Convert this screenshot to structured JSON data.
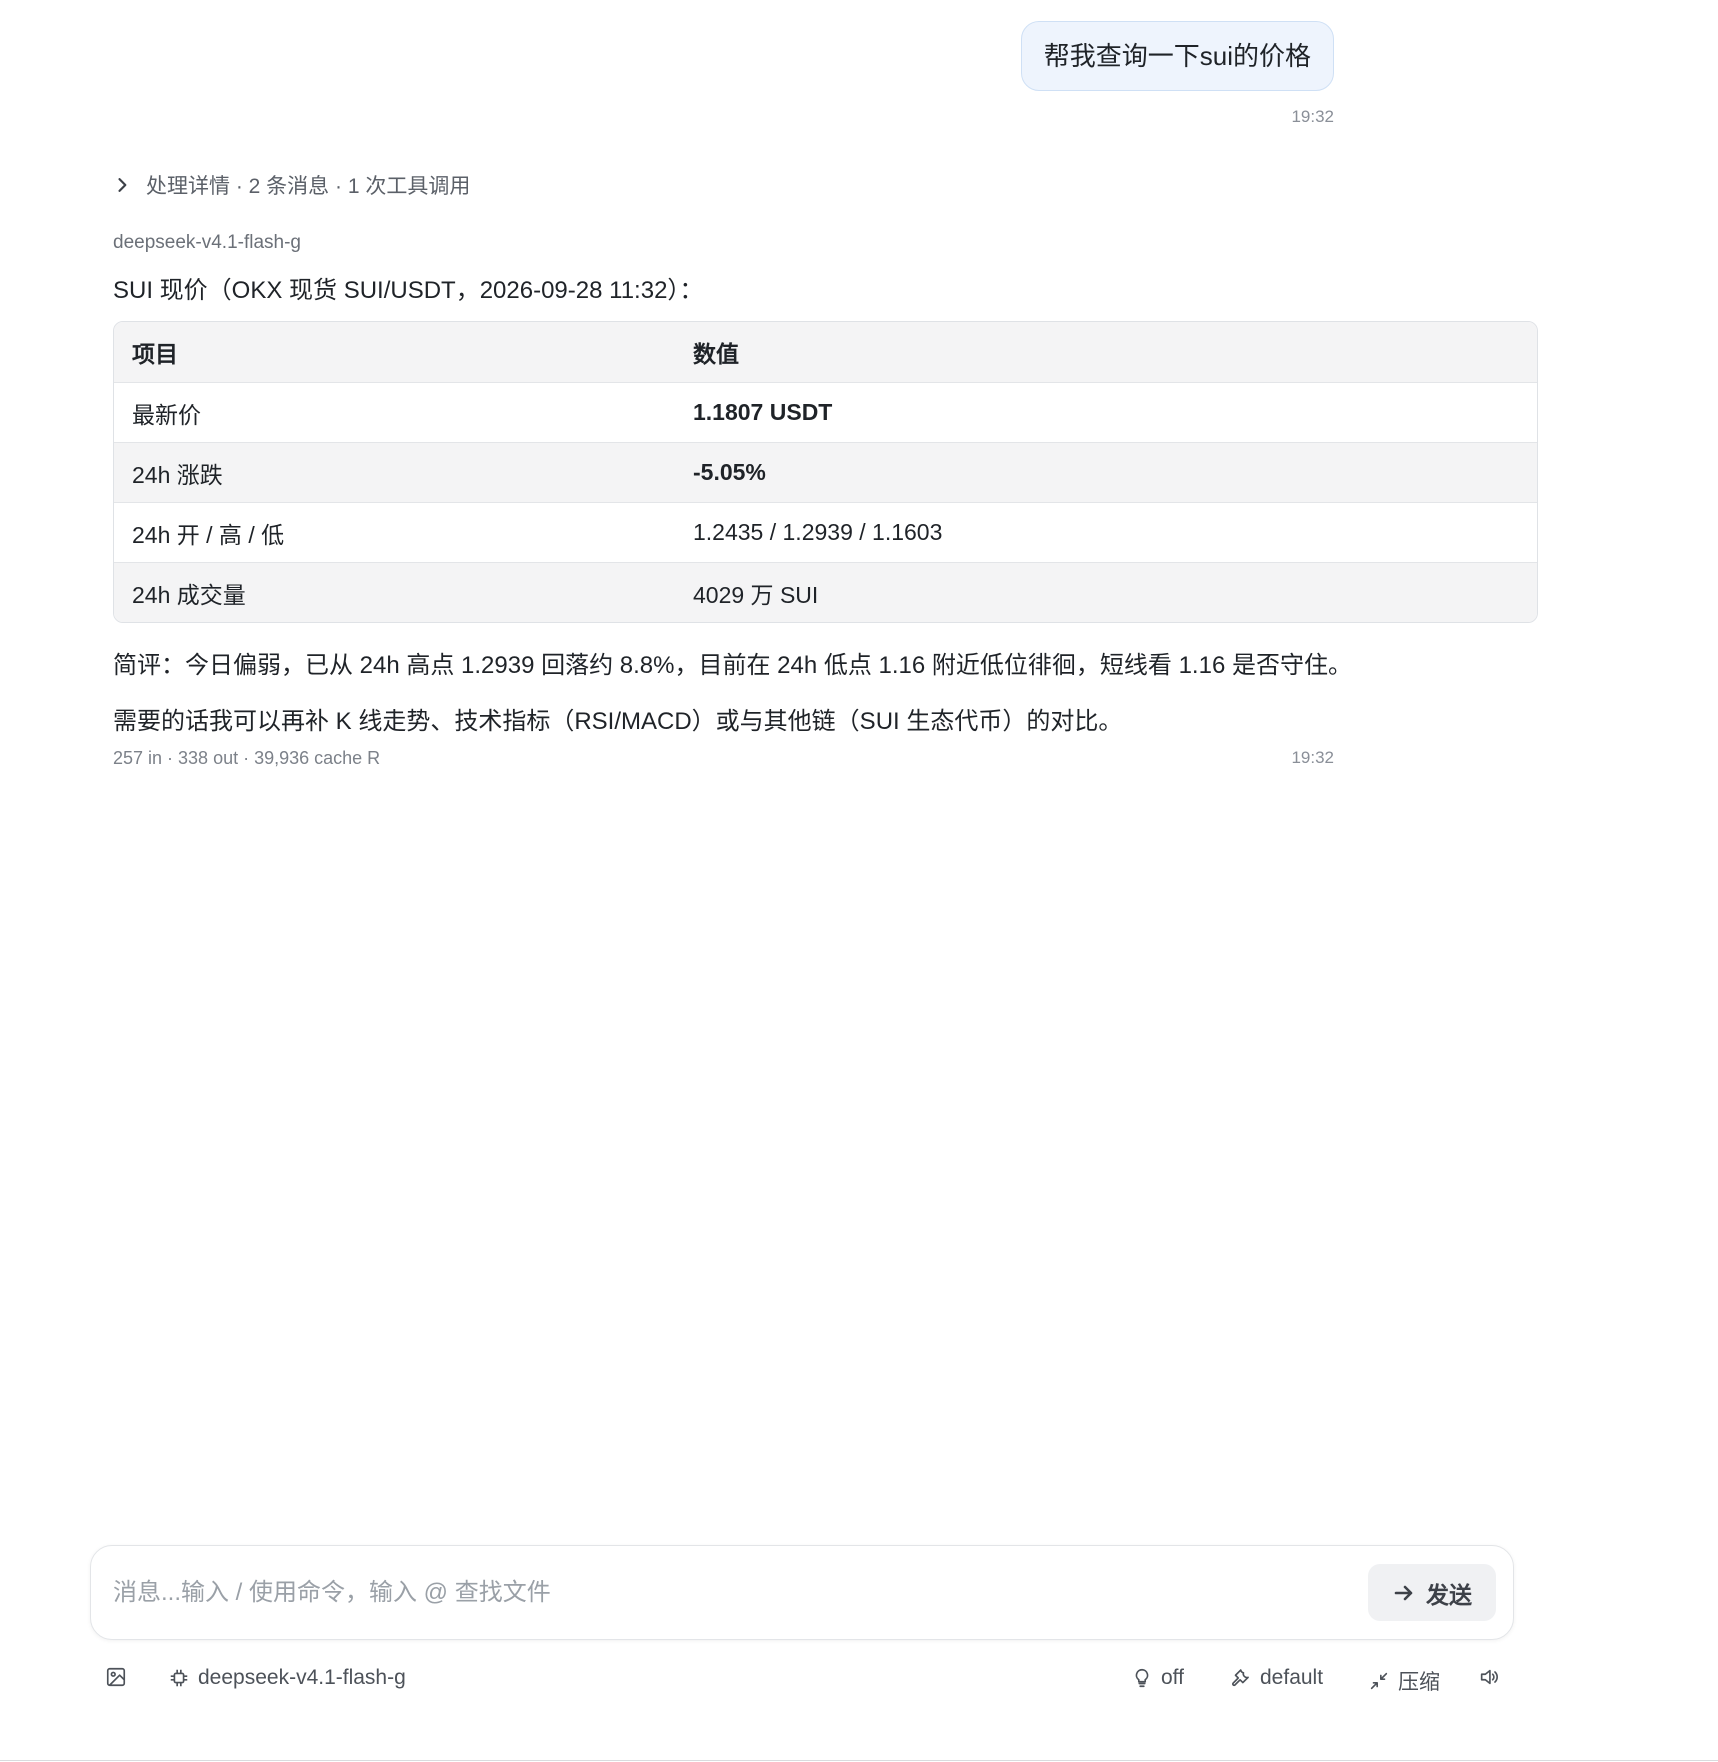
{
  "user_message": {
    "text": "帮我查询一下sui的价格",
    "time": "19:32"
  },
  "assistant": {
    "details_summary": "处理详情 · 2 条消息 · 1 次工具调用",
    "model": "deepseek-v4.1-flash-g",
    "intro": "SUI 现价（OKX 现货 SUI/USDT，2026-09-28 11:32）：",
    "table": {
      "headers": [
        "项目",
        "数值"
      ],
      "rows": [
        {
          "label": "最新价",
          "value": "1.1807 USDT"
        },
        {
          "label": "24h 涨跌",
          "value": "-5.05%"
        },
        {
          "label": "24h 开 / 高 / 低",
          "value": "1.2435 / 1.2939 / 1.1603"
        },
        {
          "label": "24h 成交量",
          "value": "4029 万 SUI"
        }
      ]
    },
    "comment": "简评：今日偏弱，已从 24h 高点 1.2939 回落约 8.8%，目前在 24h 低点 1.16 附近低位徘徊，短线看 1.16 是否守住。",
    "followup": "需要的话我可以再补 K 线走势、技术指标（RSI/MACD）或与其他链（SUI 生态代币）的对比。",
    "usage": "257 in · 338 out · 39,936 cache R",
    "time": "19:32"
  },
  "composer": {
    "placeholder": "消息...输入 / 使用命令，输入 @ 查找文件",
    "value": "",
    "send_label": "发送"
  },
  "toolbar": {
    "model": "deepseek-v4.1-flash-g",
    "thinking": "off",
    "tools": "default",
    "compress": "压缩"
  }
}
